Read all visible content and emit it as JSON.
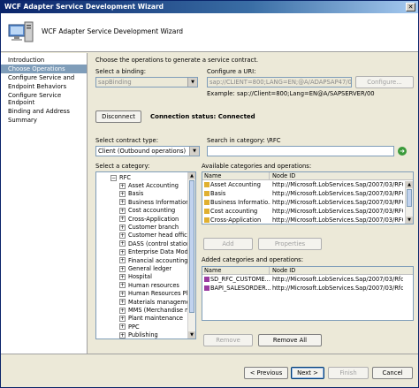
{
  "window": {
    "title": "WCF Adapter Service Development Wizard"
  },
  "header": {
    "title": "WCF Adapter Service Development Wizard"
  },
  "nav": {
    "items": [
      {
        "label": "Introduction",
        "selected": false
      },
      {
        "label": "Choose Operations",
        "selected": true
      },
      {
        "label": "Configure Service and",
        "selected": false
      },
      {
        "label": "Endpoint Behaviors",
        "selected": false
      },
      {
        "label": "Configure Service Endpoint",
        "selected": false
      },
      {
        "label": "Binding and Address",
        "selected": false
      },
      {
        "label": "Summary",
        "selected": false
      }
    ]
  },
  "main": {
    "instruction": "Choose the operations to generate a service contract.",
    "binding_label": "Select a binding:",
    "binding_value": "sapBinding",
    "uri_label": "Configure a URI:",
    "uri_value": "sap://CLIENT=800;LANG=EN;@A/ADAPSAP47/00?RfcSc",
    "configure_button": "Configure...",
    "uri_example": "Example: sap://Client=800;Lang=EN@A/SAPSERVER/00",
    "disconnect_button": "Disconnect",
    "connection_status": "Connection status: Connected",
    "contract_type_label": "Select contract type:",
    "contract_type_value": "Client (Outbound operations)",
    "search_label": "Search in category: \\RFC",
    "search_value": "",
    "category_label": "Select a category:",
    "tree_root": "RFC",
    "tree_items": [
      "Asset Accounting",
      "Basis",
      "Business Information W",
      "Cost accounting",
      "Cross-Application",
      "Customer branch",
      "Customer head office",
      "DASS (control station)",
      "Enterprise Data Model",
      "Financial accounting",
      "General ledger",
      "Hospital",
      "Human resources",
      "Human Resources Plan",
      "Materials management",
      "MMS (Merchandise mgt",
      "Plant maintenance",
      "PPC",
      "Publishing"
    ],
    "available_label": "Available categories and operations:",
    "available_columns": [
      "Name",
      "Node ID"
    ],
    "available_rows": [
      [
        "Asset Accounting",
        "http://Microsoft.LobServices.Sap/2007/03/RFCG"
      ],
      [
        "Basis",
        "http://Microsoft.LobServices.Sap/2007/03/RFCG"
      ],
      [
        "Business Informatio...",
        "http://Microsoft.LobServices.Sap/2007/03/RFCG"
      ],
      [
        "Cost accounting",
        "http://Microsoft.LobServices.Sap/2007/03/RFCG"
      ],
      [
        "Cross-Application",
        "http://Microsoft.LobServices.Sap/2007/03/RFCG"
      ]
    ],
    "add_button": "Add",
    "properties_button": "Properties",
    "added_label": "Added categories and operations:",
    "added_columns": [
      "Name",
      "Node ID"
    ],
    "added_rows": [
      [
        "SD_RFC_CUSTOME...",
        "http://Microsoft.LobServices.Sap/2007/03/Rfc/S"
      ],
      [
        "BAPI_SALESORDER...",
        "http://Microsoft.LobServices.Sap/2007/03/Rfc/B"
      ]
    ],
    "remove_button": "Remove",
    "remove_all_button": "Remove All"
  },
  "footer": {
    "previous": "< Previous",
    "next": "Next >",
    "finish": "Finish",
    "cancel": "Cancel"
  },
  "icons": {
    "folder": "folder-icon",
    "operation": "operation-icon",
    "search_go": "go-arrow-icon"
  },
  "colors": {
    "title_start": "#0a246a",
    "nav_selected": "#7f9db9",
    "go_green": "#3a9a3a"
  }
}
